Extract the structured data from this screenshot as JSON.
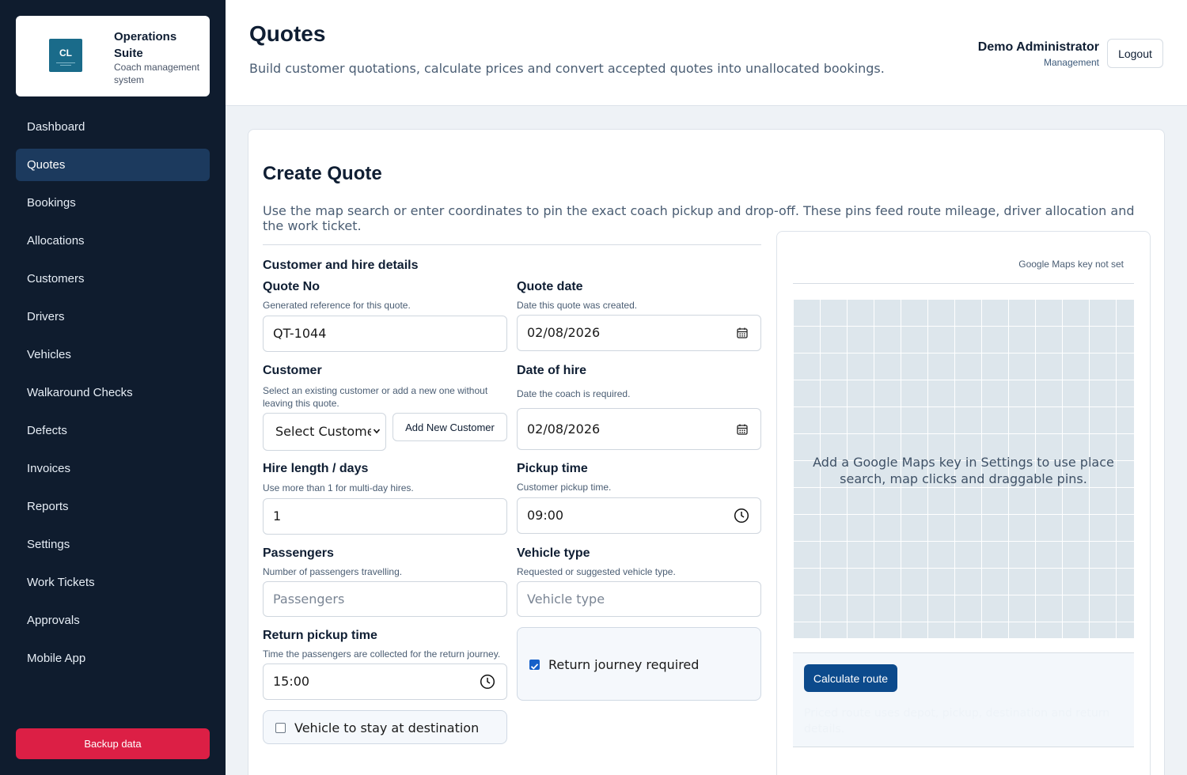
{
  "brand": {
    "logo_text": "CL",
    "name": "Operations Suite",
    "subtitle": "Coach management system"
  },
  "nav": {
    "items": [
      {
        "label": "Dashboard",
        "active": false
      },
      {
        "label": "Quotes",
        "active": true
      },
      {
        "label": "Bookings",
        "active": false
      },
      {
        "label": "Allocations",
        "active": false
      },
      {
        "label": "Customers",
        "active": false
      },
      {
        "label": "Drivers",
        "active": false
      },
      {
        "label": "Vehicles",
        "active": false
      },
      {
        "label": "Walkaround Checks",
        "active": false
      },
      {
        "label": "Defects",
        "active": false
      },
      {
        "label": "Invoices",
        "active": false
      },
      {
        "label": "Reports",
        "active": false
      },
      {
        "label": "Settings",
        "active": false
      },
      {
        "label": "Work Tickets",
        "active": false
      },
      {
        "label": "Approvals",
        "active": false
      },
      {
        "label": "Mobile App",
        "active": false
      }
    ],
    "backup_label": "Backup data"
  },
  "header": {
    "title": "Quotes",
    "subtitle": "Build customer quotations, calculate prices and convert accepted quotes into unallocated bookings.",
    "user_name": "Demo Administrator",
    "user_role": "Management",
    "logout_label": "Logout"
  },
  "form": {
    "title": "Create Quote",
    "description": "Use the map search or enter coordinates to pin the exact coach pickup and drop-off. These pins feed route mileage, driver allocation and the work ticket.",
    "section_title": "Customer and hire details",
    "quote_no": {
      "label": "Quote No",
      "help": "Generated reference for this quote.",
      "value": "QT-1044"
    },
    "quote_date": {
      "label": "Quote date",
      "help": "Date this quote was created.",
      "value": "02/08/2026",
      "icon": "calendar-icon"
    },
    "customer": {
      "label": "Customer",
      "help": "Select an existing customer or add a new one without leaving this quote.",
      "selected": "Select Customer",
      "add_label": "Add New Customer"
    },
    "date_of_hire": {
      "label": "Date of hire",
      "help": "Date the coach is required.",
      "value": "02/08/2026",
      "icon": "calendar-icon"
    },
    "hire_length": {
      "label": "Hire length / days",
      "help": "Use more than 1 for multi-day hires.",
      "value": "1"
    },
    "pickup_time": {
      "label": "Pickup time",
      "help": "Customer pickup time.",
      "value": "09:00",
      "icon": "clock-icon"
    },
    "passengers": {
      "label": "Passengers",
      "help": "Number of passengers travelling.",
      "placeholder": "Passengers"
    },
    "vehicle_type": {
      "label": "Vehicle type",
      "help": "Requested or suggested vehicle type.",
      "placeholder": "Vehicle type"
    },
    "return_pickup_time": {
      "label": "Return pickup time",
      "help": "Time the passengers are collected for the return journey.",
      "value": "15:00",
      "icon": "clock-icon"
    },
    "return_journey": {
      "label": "Return journey required",
      "checked": true
    },
    "stay_at_destination": {
      "label": "Vehicle to stay at destination",
      "checked": false
    }
  },
  "map": {
    "key_note": "Google Maps key not set",
    "message": "Add a Google Maps key in Settings to use place search, map clicks and draggable pins.",
    "calc_label": "Calculate route",
    "route_note": "Priced route uses depot, pickup, destination and return details."
  },
  "colors": {
    "sidebar_bg": "#0f1c2e",
    "nav_active": "#1c3a5e",
    "backup": "#dc1f45",
    "primary": "#0c4a8c",
    "checkbox": "#1560c9"
  }
}
